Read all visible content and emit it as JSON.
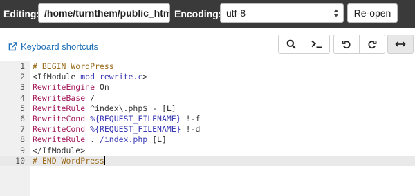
{
  "header": {
    "editing_label": "Editing:",
    "path_value": "/home/turnthem/public_html/.htaccess",
    "encoding_label": "Encoding:",
    "encoding_value": "utf-8",
    "reopen_label": "Re-open"
  },
  "toolbar": {
    "keyboard_shortcuts": "Keyboard shortcuts",
    "buttons": [
      "search-icon",
      "terminal-icon",
      "undo-icon",
      "redo-icon",
      "wrap-toggle-icon"
    ]
  },
  "editor": {
    "active_line": 10,
    "lines": [
      {
        "num": "1",
        "parts": [
          {
            "t": "# BEGIN WordPress",
            "c": "comment"
          }
        ]
      },
      {
        "num": "2",
        "parts": [
          {
            "t": "<IfModule ",
            "c": "plain"
          },
          {
            "t": "mod_rewrite.c",
            "c": "var"
          },
          {
            "t": ">",
            "c": "plain"
          }
        ]
      },
      {
        "num": "3",
        "parts": [
          {
            "t": "RewriteEngine",
            "c": "key"
          },
          {
            "t": " On",
            "c": "plain"
          }
        ]
      },
      {
        "num": "4",
        "parts": [
          {
            "t": "RewriteBase",
            "c": "key"
          },
          {
            "t": " /",
            "c": "plain"
          }
        ]
      },
      {
        "num": "5",
        "parts": [
          {
            "t": "RewriteRule",
            "c": "key"
          },
          {
            "t": " ^index\\.php$ - [L]",
            "c": "plain"
          }
        ]
      },
      {
        "num": "6",
        "parts": [
          {
            "t": "RewriteCond",
            "c": "key"
          },
          {
            "t": " ",
            "c": "plain"
          },
          {
            "t": "%{REQUEST_FILENAME}",
            "c": "var"
          },
          {
            "t": " !-f",
            "c": "plain"
          }
        ]
      },
      {
        "num": "7",
        "parts": [
          {
            "t": "RewriteCond",
            "c": "key"
          },
          {
            "t": " ",
            "c": "plain"
          },
          {
            "t": "%{REQUEST_FILENAME}",
            "c": "var"
          },
          {
            "t": " !-d",
            "c": "plain"
          }
        ]
      },
      {
        "num": "8",
        "parts": [
          {
            "t": "RewriteRule",
            "c": "key"
          },
          {
            "t": " . ",
            "c": "plain"
          },
          {
            "t": "/index.php",
            "c": "var"
          },
          {
            "t": " [L]",
            "c": "plain"
          }
        ]
      },
      {
        "num": "9",
        "parts": [
          {
            "t": "</IfModule>",
            "c": "plain"
          }
        ]
      },
      {
        "num": "10",
        "parts": [
          {
            "t": "# END WordPress",
            "c": "comment"
          }
        ]
      }
    ]
  },
  "colors": {
    "header_bg": "#3a3a3a",
    "link": "#1d6fb8",
    "comment": "#9a6a1a",
    "keyword": "#a3195b",
    "variable": "#3b3bb5"
  }
}
